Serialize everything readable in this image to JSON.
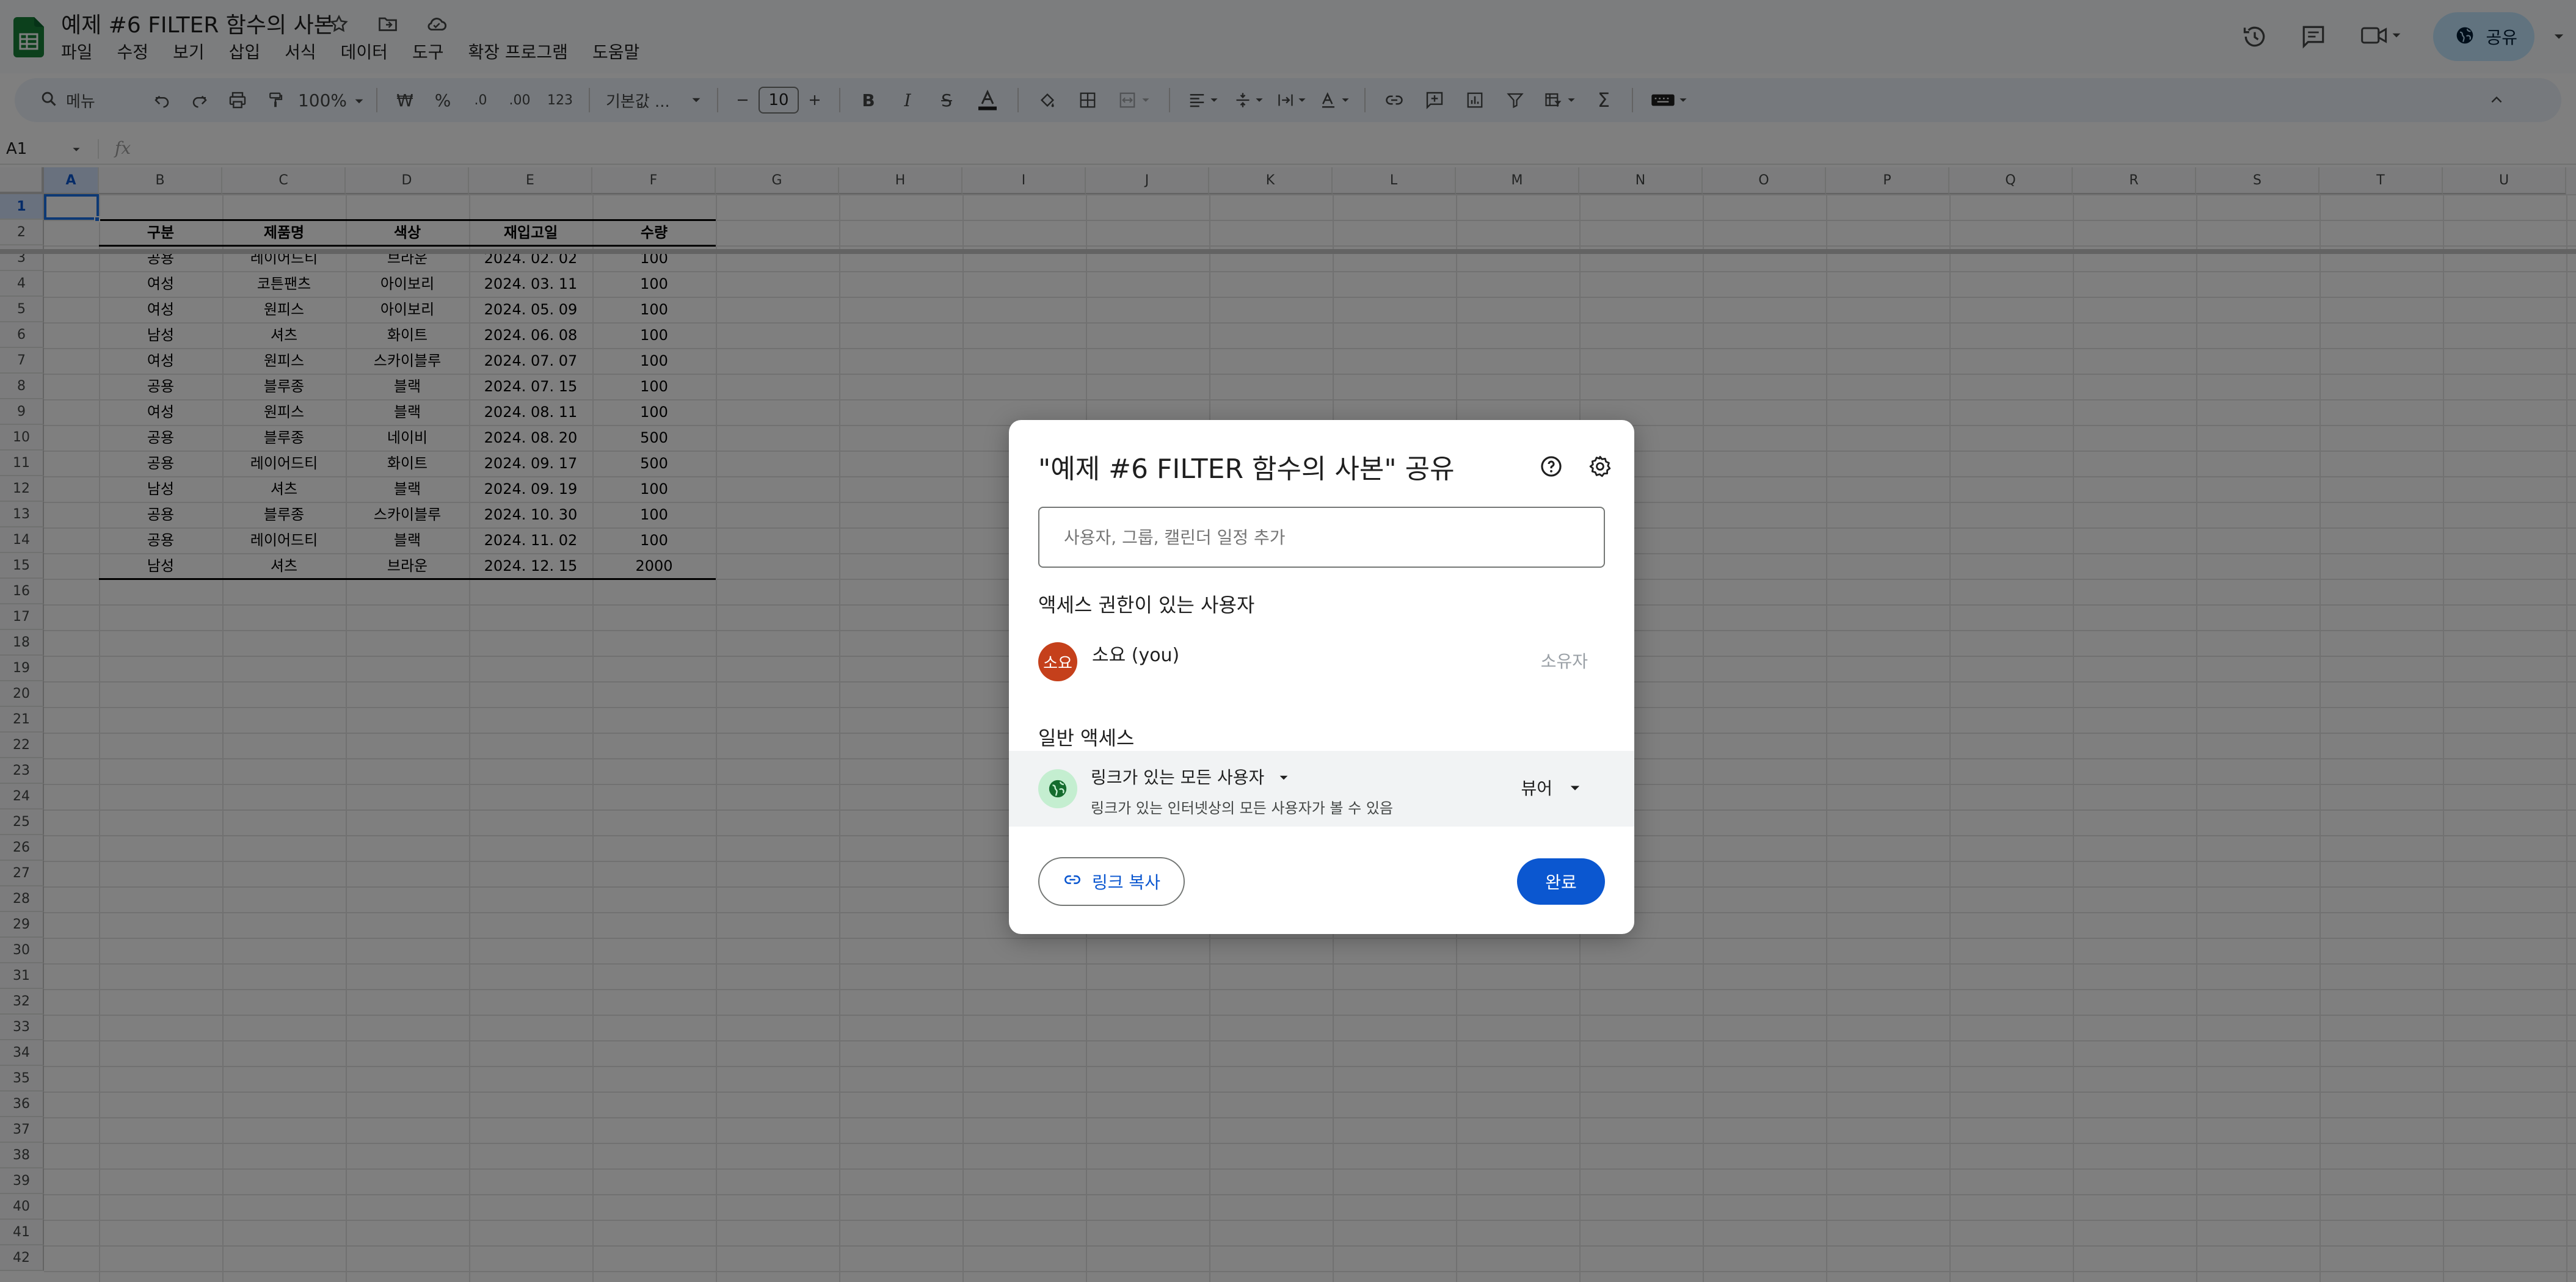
{
  "document": {
    "title": "예제 #6 FILTER 함수의 사본"
  },
  "menu": [
    "파일",
    "수정",
    "보기",
    "삽입",
    "서식",
    "데이터",
    "도구",
    "확장 프로그램",
    "도움말"
  ],
  "header": {
    "share_label": "공유"
  },
  "toolbar": {
    "search_label": "메뉴",
    "zoom": "100%",
    "currency": "₩",
    "percent": "%",
    "decrease_decimal": ".0",
    "increase_decimal": ".00",
    "number_format": "123",
    "font": "기본값 ...",
    "font_size": "10"
  },
  "formula_bar": {
    "cell_ref": "A1",
    "fx": "fx"
  },
  "grid": {
    "columns": [
      "A",
      "B",
      "C",
      "D",
      "E",
      "F",
      "G",
      "H",
      "I",
      "J",
      "K",
      "L",
      "M",
      "N",
      "O",
      "P",
      "Q",
      "R",
      "S",
      "T",
      "U"
    ],
    "headers": [
      "구분",
      "제품명",
      "색상",
      "재입고일",
      "수량"
    ],
    "rows": [
      [
        "공용",
        "레이어드티",
        "브라운",
        "2024. 02. 02",
        "100"
      ],
      [
        "여성",
        "코튼팬츠",
        "아이보리",
        "2024. 03. 11",
        "100"
      ],
      [
        "여성",
        "원피스",
        "아이보리",
        "2024. 05. 09",
        "100"
      ],
      [
        "남성",
        "셔츠",
        "화이트",
        "2024. 06. 08",
        "100"
      ],
      [
        "여성",
        "원피스",
        "스카이블루",
        "2024. 07. 07",
        "100"
      ],
      [
        "공용",
        "블루종",
        "블랙",
        "2024. 07. 15",
        "100"
      ],
      [
        "여성",
        "원피스",
        "블랙",
        "2024. 08. 11",
        "100"
      ],
      [
        "공용",
        "블루종",
        "네이비",
        "2024. 08. 20",
        "500"
      ],
      [
        "공용",
        "레이어드티",
        "화이트",
        "2024. 09. 17",
        "500"
      ],
      [
        "남성",
        "셔츠",
        "블랙",
        "2024. 09. 19",
        "100"
      ],
      [
        "공용",
        "블루종",
        "스카이블루",
        "2024. 10. 30",
        "100"
      ],
      [
        "공용",
        "레이어드티",
        "블랙",
        "2024. 11. 02",
        "100"
      ],
      [
        "남성",
        "셔츠",
        "브라운",
        "2024. 12. 15",
        "2000"
      ]
    ]
  },
  "dialog": {
    "title": "\"예제 #6 FILTER 함수의 사본\" 공유",
    "input_placeholder": "사용자, 그룹, 캘린더 일정 추가",
    "section_people": "액세스 권한이 있는 사용자",
    "user": {
      "initials": "소요",
      "name": "소요 (you)",
      "role": "소유자"
    },
    "section_general": "일반 액세스",
    "access": {
      "who": "링크가 있는 모든 사용자",
      "description": "링크가 있는 인터넷상의 모든 사용자가 볼 수 있음",
      "role": "뷰어"
    },
    "copy_link": "링크 복사",
    "done": "완료"
  },
  "colors": {
    "accent": "#0b57d0",
    "share_button": "#c2e7ff",
    "avatar": "#c5401b",
    "globe_bg": "#c4eed0",
    "sheets_green": "#188038"
  }
}
